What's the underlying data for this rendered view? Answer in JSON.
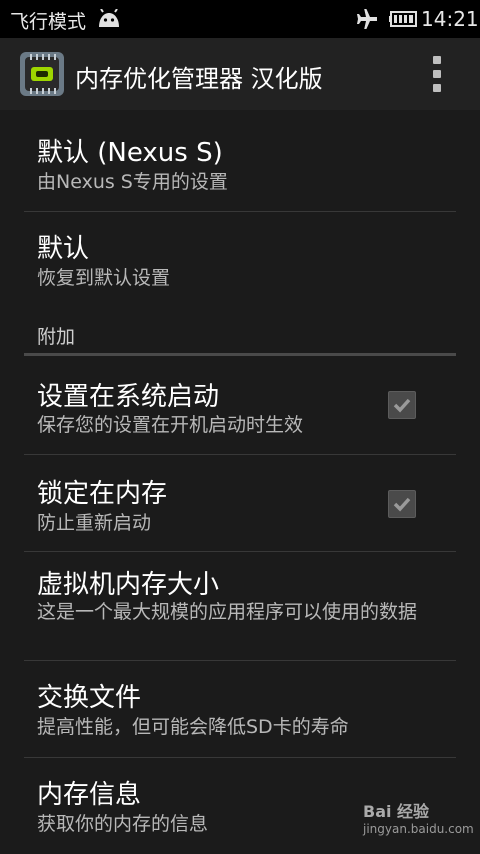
{
  "status_bar": {
    "airplane_mode": "飞行模式",
    "time": "14:21",
    "icons": [
      "android-icon",
      "airplane-icon",
      "battery-icon"
    ]
  },
  "action_bar": {
    "app_icon": "memory-chip-icon",
    "title": "内存优化管理器 汉化版",
    "overflow_icon": "overflow-menu-icon"
  },
  "items": [
    {
      "title": "默认 (Nexus S)",
      "summary": "由Nexus S专用的设置"
    },
    {
      "title": "默认",
      "summary": "恢复到默认设置"
    }
  ],
  "section": {
    "header": "附加"
  },
  "extra_items": [
    {
      "title": "设置在系统启动",
      "summary": "保存您的设置在开机启动时生效",
      "checked": true
    },
    {
      "title": "锁定在内存",
      "summary": "防止重新启动",
      "checked": true
    },
    {
      "title": "虚拟机内存大小",
      "summary": "这是一个最大规模的应用程序可以使用的数据"
    },
    {
      "title": "交换文件",
      "summary": "提高性能，但可能会降低SD卡的寿命"
    },
    {
      "title": "内存信息",
      "summary": "获取你的内存的信息"
    }
  ],
  "watermark": {
    "brand": "Bai 经验",
    "url": "jingyan.baidu.com"
  },
  "colors": {
    "background": "#1b1b1b",
    "action_bar": "#222222",
    "status_bar": "#000000"
  }
}
